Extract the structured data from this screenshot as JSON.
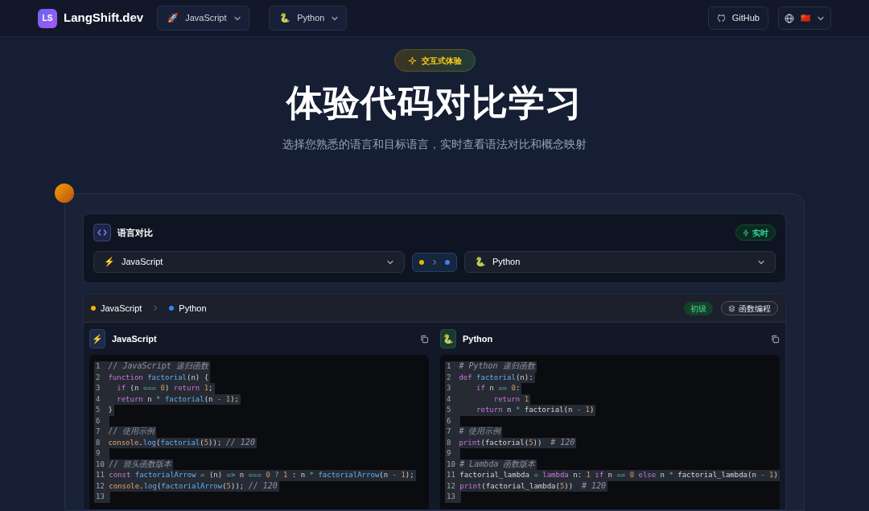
{
  "header": {
    "logo_mark": "LS",
    "brand": "LangShift.dev",
    "source_lang": {
      "emoji": "🚀",
      "label": "JavaScript"
    },
    "target_lang": {
      "emoji": "🐍",
      "label": "Python"
    },
    "github": "GitHub",
    "locale_flag": "🇨🇳"
  },
  "hero": {
    "badge": "交互式体验",
    "title": "体验代码对比学习",
    "subtitle": "选择您熟悉的语言和目标语言，实时查看语法对比和概念映射"
  },
  "selector": {
    "title": "语言对比",
    "live_badge": "实时",
    "source": {
      "emoji": "⚡",
      "label": "JavaScript",
      "color": "#eab308"
    },
    "target": {
      "emoji": "🐍",
      "label": "Python",
      "color": "#3b82f6"
    }
  },
  "comparison": {
    "source": {
      "label": "JavaScript",
      "color": "#eab308"
    },
    "target": {
      "label": "Python",
      "color": "#3b82f6"
    },
    "level_tag": "初级",
    "topic_tag": "函数编程",
    "panes": [
      {
        "emoji": "⚡",
        "title": "JavaScript",
        "lines": [
          {
            "n": "1",
            "tokens": [
              {
                "kind": "comment",
                "text": "// JavaScript 递归函数"
              }
            ]
          },
          {
            "n": "2",
            "tokens": [
              {
                "kind": "keyword",
                "text": "function "
              },
              {
                "kind": "function",
                "text": "factorial"
              },
              {
                "kind": "plain",
                "text": "(n) {"
              }
            ]
          },
          {
            "n": "3",
            "tokens": [
              {
                "kind": "keyword",
                "text": "  if "
              },
              {
                "kind": "plain",
                "text": "(n "
              },
              {
                "kind": "operator",
                "text": "==="
              },
              {
                "kind": "number",
                "text": " 0"
              },
              {
                "kind": "plain",
                "text": ") "
              },
              {
                "kind": "keyword",
                "text": "return "
              },
              {
                "kind": "number",
                "text": "1"
              },
              {
                "kind": "plain",
                "text": ";"
              }
            ]
          },
          {
            "n": "4",
            "tokens": [
              {
                "kind": "keyword",
                "text": "  return "
              },
              {
                "kind": "plain",
                "text": "n "
              },
              {
                "kind": "operator",
                "text": "* "
              },
              {
                "kind": "function",
                "text": "factorial"
              },
              {
                "kind": "plain",
                "text": "(n "
              },
              {
                "kind": "operator",
                "text": "- "
              },
              {
                "kind": "number",
                "text": "1"
              },
              {
                "kind": "plain",
                "text": ");"
              }
            ]
          },
          {
            "n": "5",
            "tokens": [
              {
                "kind": "plain",
                "text": "}"
              }
            ]
          },
          {
            "n": "6"
          },
          {
            "n": "7",
            "tokens": [
              {
                "kind": "comment",
                "text": "// 使用示例"
              }
            ]
          },
          {
            "n": "8",
            "tokens": [
              {
                "kind": "builtin",
                "text": "console"
              },
              {
                "kind": "plain",
                "text": "."
              },
              {
                "kind": "function",
                "text": "log"
              },
              {
                "kind": "plain",
                "text": "("
              },
              {
                "kind": "function",
                "text": "factorial"
              },
              {
                "kind": "plain",
                "text": "("
              },
              {
                "kind": "number",
                "text": "5"
              },
              {
                "kind": "plain",
                "text": ")); "
              },
              {
                "kind": "comment",
                "text": "// 120"
              }
            ]
          },
          {
            "n": "9"
          },
          {
            "n": "10",
            "tokens": [
              {
                "kind": "comment",
                "text": "// 箭头函数版本"
              }
            ]
          },
          {
            "n": "11",
            "tokens": [
              {
                "kind": "keyword",
                "text": "const "
              },
              {
                "kind": "function",
                "text": "factorialArrow"
              },
              {
                "kind": "operator",
                "text": " = "
              },
              {
                "kind": "plain",
                "text": "(n) "
              },
              {
                "kind": "operator",
                "text": "=>"
              },
              {
                "kind": "plain",
                "text": " n "
              },
              {
                "kind": "operator",
                "text": "==="
              },
              {
                "kind": "number",
                "text": " 0"
              },
              {
                "kind": "operator",
                "text": " ? "
              },
              {
                "kind": "number",
                "text": "1"
              },
              {
                "kind": "plain",
                "text": " : n "
              },
              {
                "kind": "operator",
                "text": "* "
              },
              {
                "kind": "function",
                "text": "factorialArrow"
              },
              {
                "kind": "plain",
                "text": "(n "
              },
              {
                "kind": "operator",
                "text": "- "
              },
              {
                "kind": "number",
                "text": "1"
              },
              {
                "kind": "plain",
                "text": ");"
              }
            ]
          },
          {
            "n": "12",
            "tokens": [
              {
                "kind": "builtin",
                "text": "console"
              },
              {
                "kind": "plain",
                "text": "."
              },
              {
                "kind": "function",
                "text": "log"
              },
              {
                "kind": "plain",
                "text": "("
              },
              {
                "kind": "function",
                "text": "factorialArrow"
              },
              {
                "kind": "plain",
                "text": "("
              },
              {
                "kind": "number",
                "text": "5"
              },
              {
                "kind": "plain",
                "text": ")); "
              },
              {
                "kind": "comment",
                "text": "// 120"
              }
            ]
          },
          {
            "n": "13"
          }
        ]
      },
      {
        "emoji": "🐍",
        "title": "Python",
        "lines": [
          {
            "n": "1",
            "tokens": [
              {
                "kind": "comment",
                "text": "# Python 递归函数"
              }
            ]
          },
          {
            "n": "2",
            "tokens": [
              {
                "kind": "keyword",
                "text": "def "
              },
              {
                "kind": "function",
                "text": "factorial"
              },
              {
                "kind": "plain",
                "text": "(n):"
              }
            ]
          },
          {
            "n": "3",
            "tokens": [
              {
                "kind": "keyword",
                "text": "    if "
              },
              {
                "kind": "plain",
                "text": "n "
              },
              {
                "kind": "operator",
                "text": "=="
              },
              {
                "kind": "number",
                "text": " 0"
              },
              {
                "kind": "plain",
                "text": ":"
              }
            ]
          },
          {
            "n": "4",
            "tokens": [
              {
                "kind": "keyword",
                "text": "        return "
              },
              {
                "kind": "number",
                "text": "1"
              }
            ]
          },
          {
            "n": "5",
            "tokens": [
              {
                "kind": "keyword",
                "text": "    return "
              },
              {
                "kind": "plain",
                "text": "n "
              },
              {
                "kind": "operator",
                "text": "* "
              },
              {
                "kind": "plain",
                "text": "factorial(n "
              },
              {
                "kind": "operator",
                "text": "- "
              },
              {
                "kind": "number",
                "text": "1"
              },
              {
                "kind": "plain",
                "text": ")"
              }
            ]
          },
          {
            "n": "6"
          },
          {
            "n": "7",
            "tokens": [
              {
                "kind": "comment",
                "text": "# 使用示例"
              }
            ]
          },
          {
            "n": "8",
            "tokens": [
              {
                "kind": "keyword",
                "text": "print"
              },
              {
                "kind": "plain",
                "text": "(factorial("
              },
              {
                "kind": "number",
                "text": "5"
              },
              {
                "kind": "plain",
                "text": "))  "
              },
              {
                "kind": "comment",
                "text": "# 120"
              }
            ]
          },
          {
            "n": "9"
          },
          {
            "n": "10",
            "tokens": [
              {
                "kind": "comment",
                "text": "# Lambda 函数版本"
              }
            ]
          },
          {
            "n": "11",
            "tokens": [
              {
                "kind": "plain",
                "text": "factorial_lambda "
              },
              {
                "kind": "operator",
                "text": "= "
              },
              {
                "kind": "keyword",
                "text": "lambda "
              },
              {
                "kind": "plain",
                "text": "n: "
              },
              {
                "kind": "number",
                "text": "1 "
              },
              {
                "kind": "keyword",
                "text": "if "
              },
              {
                "kind": "plain",
                "text": "n "
              },
              {
                "kind": "operator",
                "text": "=="
              },
              {
                "kind": "number",
                "text": " 0 "
              },
              {
                "kind": "keyword",
                "text": "else "
              },
              {
                "kind": "plain",
                "text": "n "
              },
              {
                "kind": "operator",
                "text": "* "
              },
              {
                "kind": "plain",
                "text": "factorial_lambda(n "
              },
              {
                "kind": "operator",
                "text": "- "
              },
              {
                "kind": "number",
                "text": "1"
              },
              {
                "kind": "plain",
                "text": ")"
              }
            ]
          },
          {
            "n": "12",
            "tokens": [
              {
                "kind": "keyword",
                "text": "print"
              },
              {
                "kind": "plain",
                "text": "(factorial_lambda("
              },
              {
                "kind": "number",
                "text": "5"
              },
              {
                "kind": "plain",
                "text": "))  "
              },
              {
                "kind": "comment",
                "text": "# 120"
              }
            ]
          },
          {
            "n": "13"
          }
        ]
      }
    ]
  }
}
